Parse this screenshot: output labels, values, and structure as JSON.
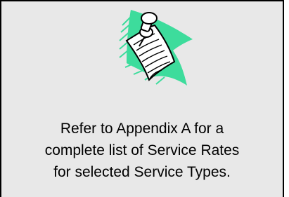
{
  "note": {
    "icon": "pinned-note-icon",
    "lines": [
      "Refer to Appendix A for a",
      "complete list of Service Rates",
      "for selected Service Types."
    ]
  },
  "colors": {
    "box_background": "#e8e8e8",
    "border": "#000000",
    "streak_green": "#3ddc9c",
    "text": "#000000"
  }
}
